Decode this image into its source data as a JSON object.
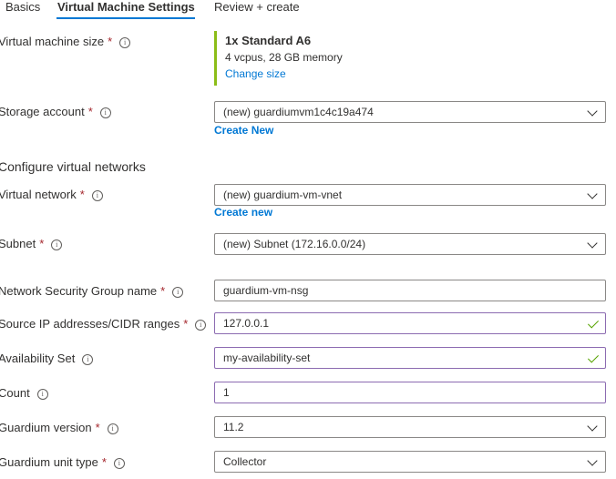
{
  "tabs": {
    "basics": "Basics",
    "vm_settings": "Virtual Machine Settings",
    "review": "Review + create"
  },
  "vm_size": {
    "label": "Virtual machine size",
    "title": "1x Standard A6",
    "desc": "4 vcpus, 28 GB memory",
    "change_link": "Change size"
  },
  "storage": {
    "label": "Storage account",
    "value": "(new) guardiumvm1c4c19a474",
    "create_link": "Create New"
  },
  "section": {
    "title": "Configure virtual networks"
  },
  "vnet": {
    "label": "Virtual network",
    "value": "(new) guardium-vm-vnet",
    "create_link": "Create new"
  },
  "subnet": {
    "label": "Subnet",
    "value": "(new) Subnet (172.16.0.0/24)"
  },
  "nsg": {
    "label": "Network Security Group name",
    "value": "guardium-vm-nsg"
  },
  "source_ip": {
    "label": "Source IP addresses/CIDR ranges",
    "value": "127.0.0.1"
  },
  "availability": {
    "label": "Availability Set",
    "value": "my-availability-set"
  },
  "count": {
    "label": "Count",
    "value": "1"
  },
  "version": {
    "label": "Guardium version",
    "value": "11.2"
  },
  "unit_type": {
    "label": "Guardium unit type",
    "value": "Collector"
  },
  "common": {
    "required_mark": "*",
    "info_glyph": "i"
  },
  "colors": {
    "accent": "#0078d4",
    "required": "#a4262c",
    "valid_border": "#8c6bb1",
    "check": "#57a300",
    "size_bar": "#8cbd18"
  }
}
